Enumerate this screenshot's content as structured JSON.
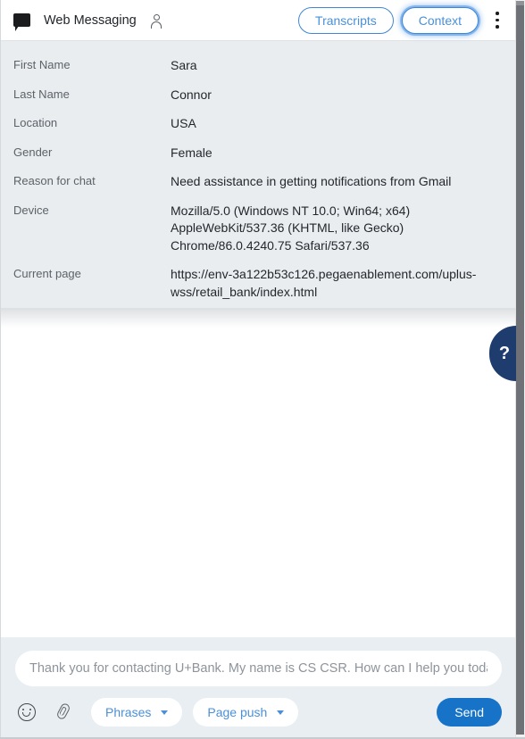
{
  "header": {
    "app_icon": "chat-bubble-icon",
    "title": "Web Messaging",
    "person_icon": "person-icon",
    "transcripts_label": "Transcripts",
    "context_label": "Context",
    "kebab_icon": "more-vertical-icon",
    "accent_color": "#4a90d9"
  },
  "context": {
    "rows": [
      {
        "label": "First Name",
        "value": [
          "Sara"
        ]
      },
      {
        "label": "Last Name",
        "value": [
          "Connor"
        ]
      },
      {
        "label": "Location",
        "value": [
          "USA"
        ]
      },
      {
        "label": "Gender",
        "value": [
          "Female"
        ]
      },
      {
        "label": "Reason for chat",
        "value": [
          "Need assistance in getting notifications from Gmail"
        ]
      },
      {
        "label": "Device",
        "value": [
          "Mozilla/5.0 (Windows NT 10.0; Win64; x64)",
          "AppleWebKit/537.36 (KHTML, like Gecko)",
          "Chrome/86.0.4240.75 Safari/537.36"
        ]
      },
      {
        "label": "Current page",
        "value": [
          "https://env-3a122b53c126.pegaenablement.com/uplus-",
          "wss/retail_bank/index.html"
        ]
      }
    ]
  },
  "help_tab": {
    "label": "?",
    "color": "#1f3c6e"
  },
  "composer": {
    "placeholder": "Thank you for contacting U+Bank. My name is CS CSR. How can I help you today?",
    "input_value": "",
    "emoji_icon": "smiley-icon",
    "attach_icon": "paperclip-icon",
    "phrases_label": "Phrases",
    "page_push_label": "Page push",
    "send_label": "Send",
    "send_color": "#1673c8"
  }
}
